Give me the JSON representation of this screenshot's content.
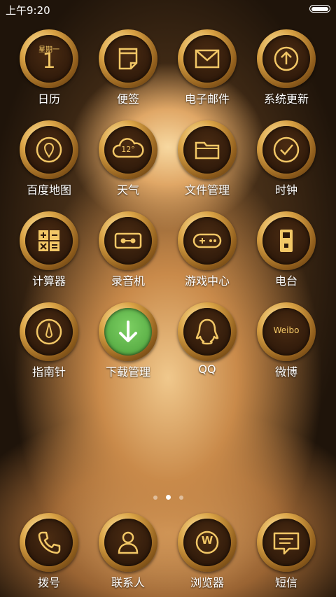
{
  "status_bar": {
    "time": "上午9:20"
  },
  "apps": [
    {
      "id": "calendar",
      "label": "日历",
      "icon": "calendar-icon",
      "weekday": "星期一",
      "date": "1"
    },
    {
      "id": "notes",
      "label": "便签",
      "icon": "notes-icon"
    },
    {
      "id": "email",
      "label": "电子邮件",
      "icon": "mail-icon"
    },
    {
      "id": "updater",
      "label": "系统更新",
      "icon": "update-arrow-icon"
    },
    {
      "id": "maps",
      "label": "百度地图",
      "icon": "map-pin-icon"
    },
    {
      "id": "weather",
      "label": "天气",
      "icon": "cloud-icon",
      "temp": "12°"
    },
    {
      "id": "files",
      "label": "文件管理",
      "icon": "folder-icon"
    },
    {
      "id": "clock",
      "label": "时钟",
      "icon": "clock-icon"
    },
    {
      "id": "calculator",
      "label": "计算器",
      "icon": "calculator-icon"
    },
    {
      "id": "recorder",
      "label": "录音机",
      "icon": "cassette-icon"
    },
    {
      "id": "games",
      "label": "游戏中心",
      "icon": "gamepad-icon"
    },
    {
      "id": "radio",
      "label": "电台",
      "icon": "radio-icon"
    },
    {
      "id": "compass",
      "label": "指南针",
      "icon": "compass-icon"
    },
    {
      "id": "downloads",
      "label": "下载管理",
      "icon": "download-icon"
    },
    {
      "id": "qq",
      "label": "QQ",
      "icon": "qq-penguin-icon"
    },
    {
      "id": "weibo",
      "label": "微博",
      "icon": "weibo-icon",
      "badge_text": "Weibo"
    }
  ],
  "dock": [
    {
      "id": "dialer",
      "label": "拨号",
      "icon": "phone-icon"
    },
    {
      "id": "contacts",
      "label": "联系人",
      "icon": "contact-icon"
    },
    {
      "id": "browser",
      "label": "浏览器",
      "icon": "browser-icon",
      "letter": "W"
    },
    {
      "id": "messages",
      "label": "短信",
      "icon": "message-icon"
    }
  ],
  "pager": {
    "pages": 3,
    "current": 2
  },
  "colors": {
    "glyph": "#f2c766",
    "download_accent": "#5aae46"
  }
}
